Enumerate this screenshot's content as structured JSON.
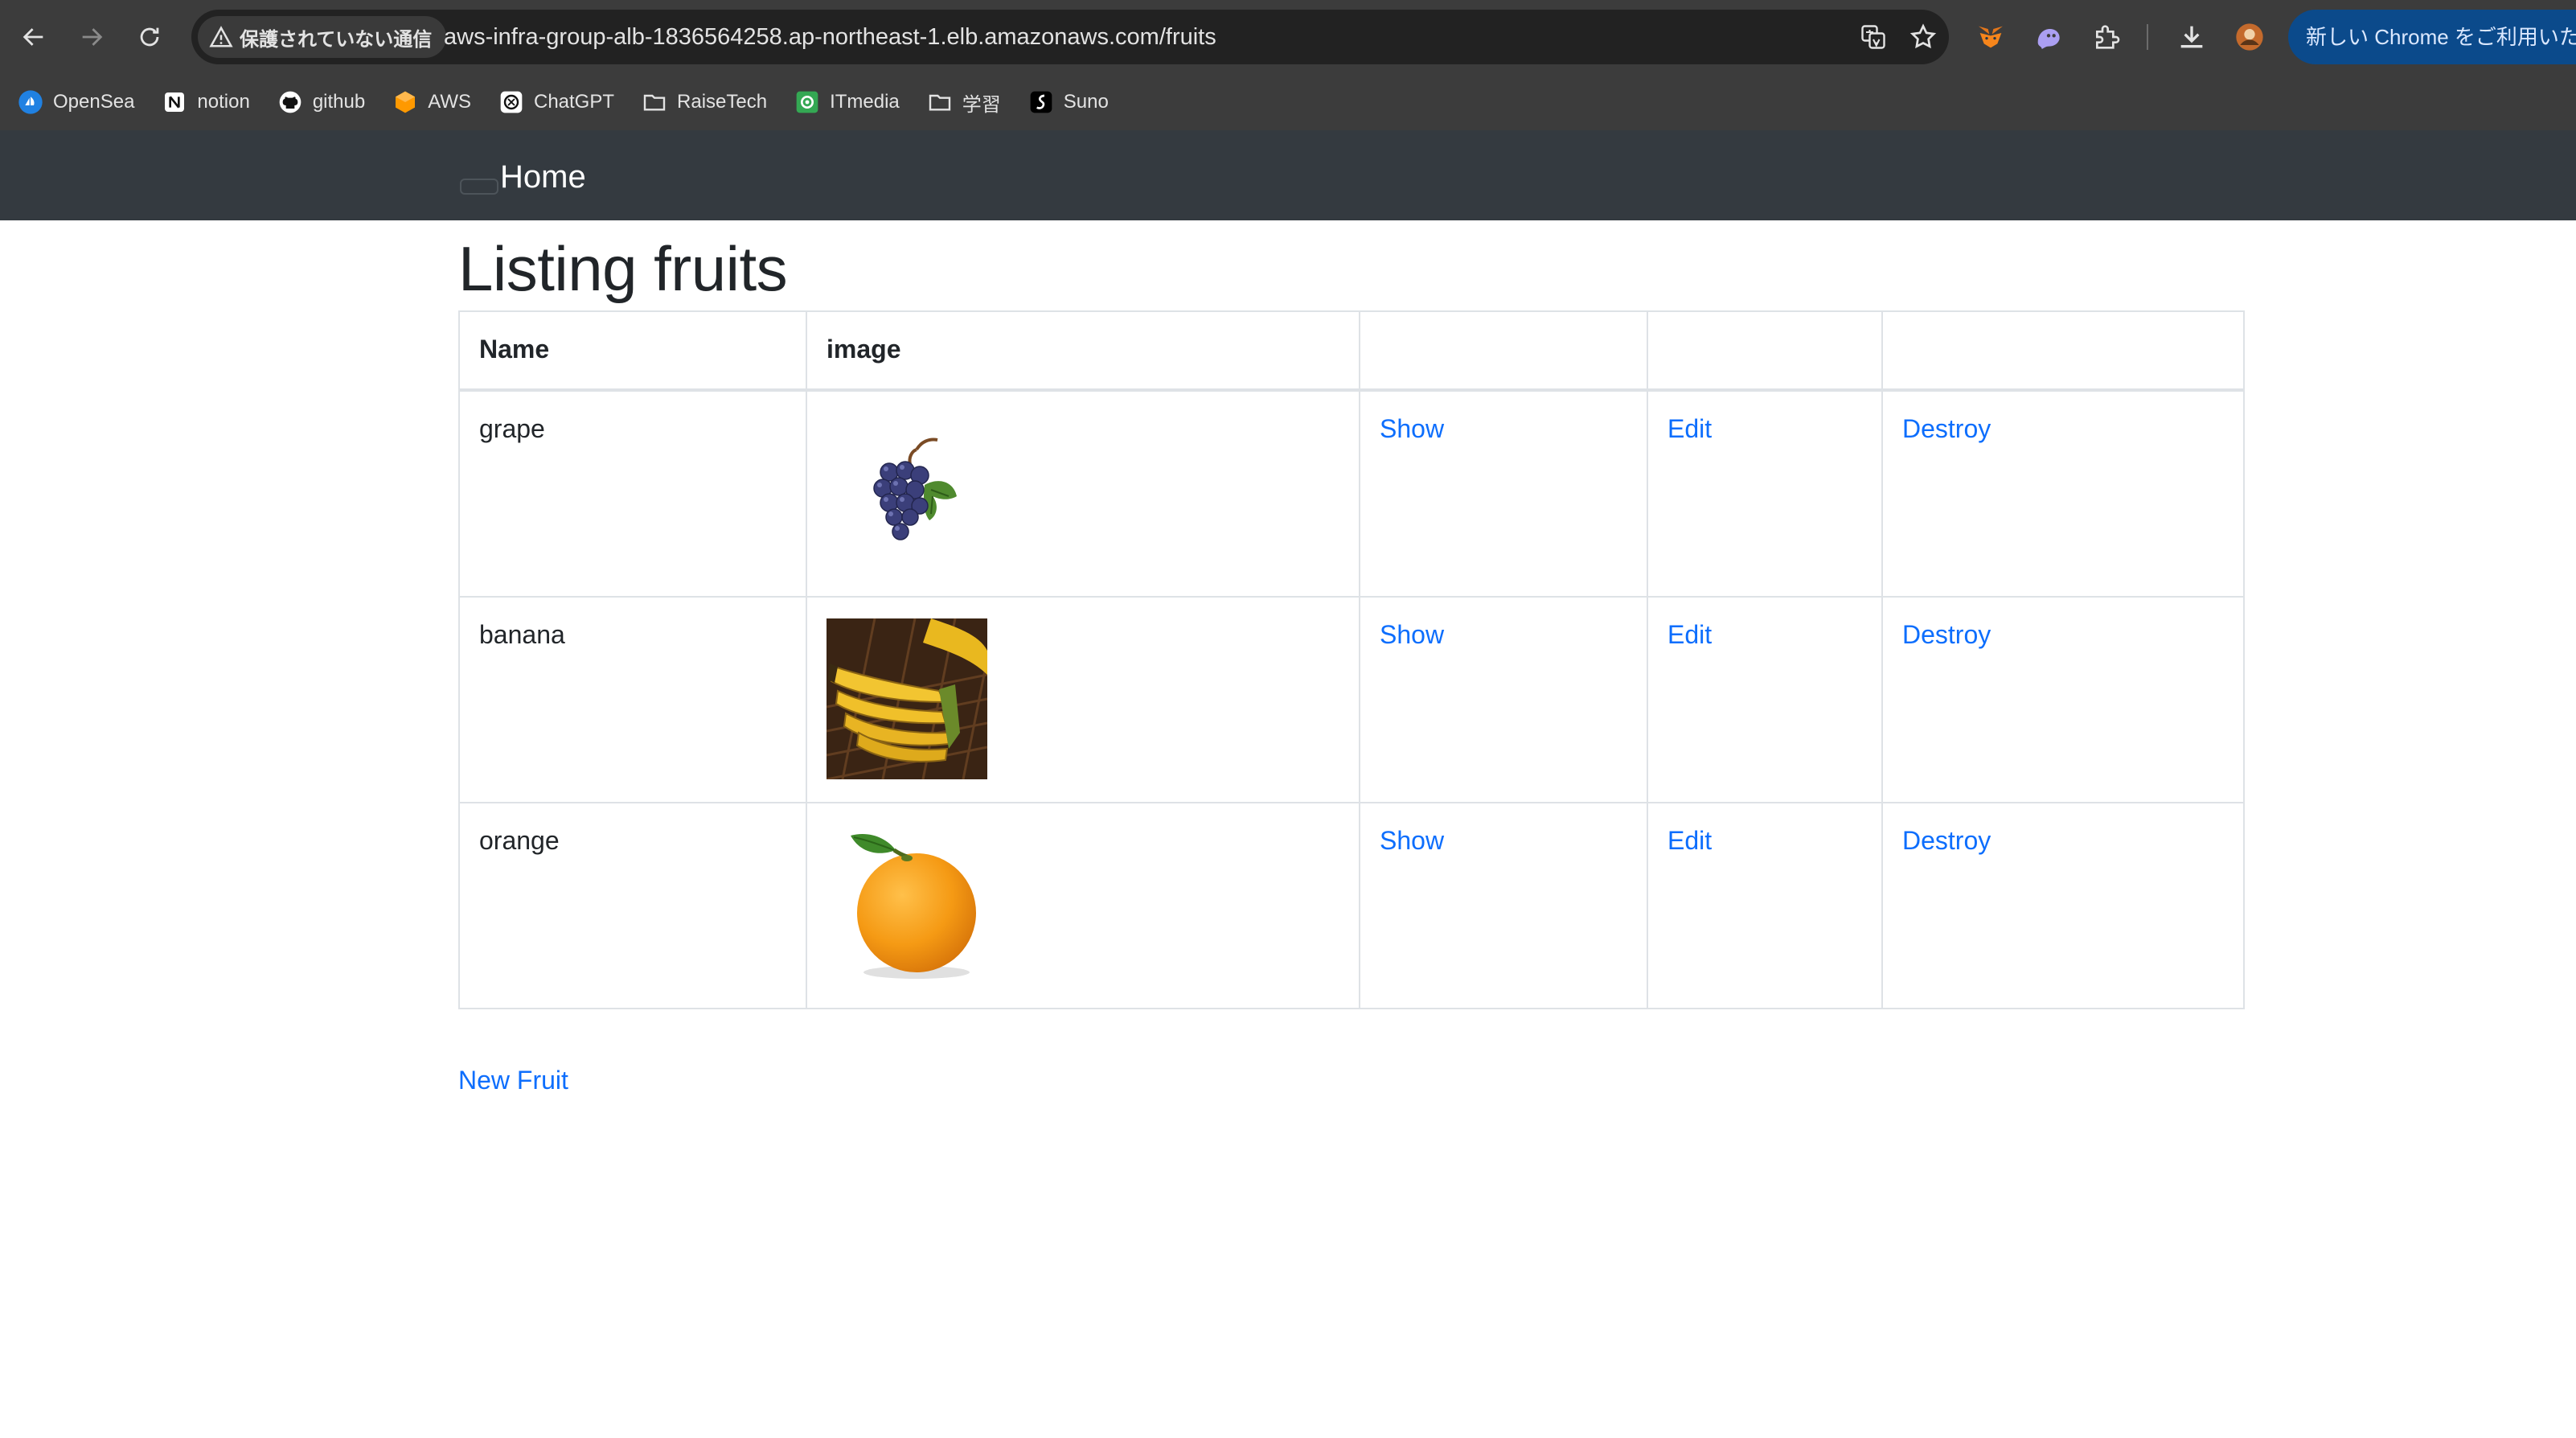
{
  "browser": {
    "security_label": "保護されていない通信",
    "url": "aws-infra-group-alb-1836564258.ap-northeast-1.elb.amazonaws.com/fruits",
    "promo_label": "新しい Chrome をご利用いた",
    "bookmarks": [
      {
        "label": "OpenSea",
        "icon": "opensea-icon"
      },
      {
        "label": "notion",
        "icon": "notion-icon"
      },
      {
        "label": "github",
        "icon": "github-icon"
      },
      {
        "label": "AWS",
        "icon": "aws-icon"
      },
      {
        "label": "ChatGPT",
        "icon": "chatgpt-icon"
      },
      {
        "label": "RaiseTech",
        "icon": "folder-icon"
      },
      {
        "label": "ITmedia",
        "icon": "itmedia-icon"
      },
      {
        "label": "学習",
        "icon": "folder-icon"
      },
      {
        "label": "Suno",
        "icon": "suno-icon"
      }
    ]
  },
  "navbar": {
    "brand": "Home"
  },
  "page": {
    "title": "Listing fruits",
    "new_link": "New Fruit"
  },
  "table": {
    "columns": [
      "Name",
      "image",
      "",
      "",
      ""
    ],
    "rows": [
      {
        "name": "grape",
        "image": "grape-image",
        "show": "Show",
        "edit": "Edit",
        "destroy": "Destroy"
      },
      {
        "name": "banana",
        "image": "banana-image",
        "show": "Show",
        "edit": "Edit",
        "destroy": "Destroy"
      },
      {
        "name": "orange",
        "image": "orange-image",
        "show": "Show",
        "edit": "Edit",
        "destroy": "Destroy"
      }
    ]
  },
  "colors": {
    "chrome_bg": "#3c3c3c",
    "navbar_bg": "#343a40",
    "link": "#0d6efd",
    "text": "#212529",
    "border": "#dee2e6"
  }
}
